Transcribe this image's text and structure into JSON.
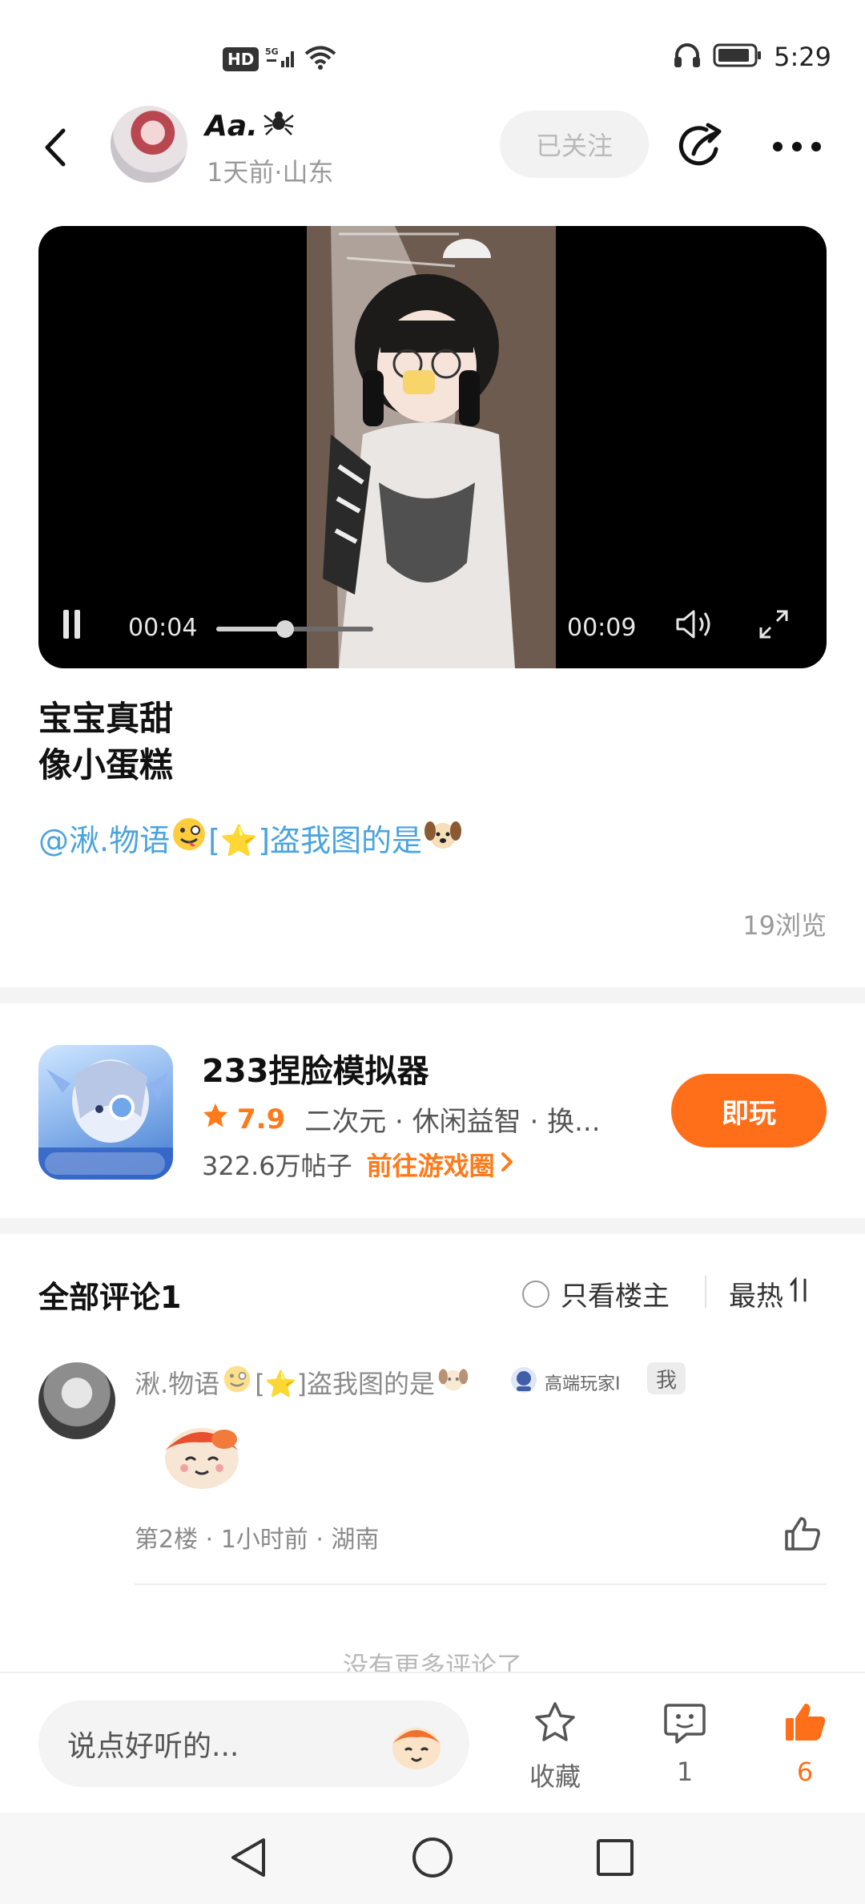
{
  "status_bar": {
    "hd": "HD",
    "network": "5G",
    "time": "5:29"
  },
  "header": {
    "author_name": "Aa.",
    "author_meta": "1天前·山东",
    "follow_label": "已关注"
  },
  "video": {
    "current_time": "00:04",
    "duration": "00:09",
    "progress": 0.44
  },
  "post": {
    "title_line1": "宝宝真甜",
    "title_line2": "像小蛋糕",
    "mention": "@湫.物语",
    "tag_text": "[⭐]盗我图的是",
    "views": "19浏览"
  },
  "game": {
    "name": "233捏脸模拟器",
    "score": "7.9",
    "tags": "二次元 · 休闲益智 · 换...",
    "posts": "322.6万帖子",
    "link": "前往游戏圈",
    "play_label": "即玩"
  },
  "comments": {
    "title": "全部评论1",
    "only_author": "只看楼主",
    "sort": "最热",
    "items": [
      {
        "name": "湫.物语",
        "name_tag": "[⭐]盗我图的是",
        "badge": "高端玩家Ⅰ",
        "me": "我",
        "meta": "第2楼 · 1小时前 · 湖南"
      }
    ],
    "no_more": "没有更多评论了"
  },
  "action_bar": {
    "input_placeholder": "说点好听的...",
    "favorite_label": "收藏",
    "comment_count": "1",
    "like_count": "6"
  },
  "colors": {
    "accent": "#ff6f1a",
    "mention": "#4aa3df"
  }
}
